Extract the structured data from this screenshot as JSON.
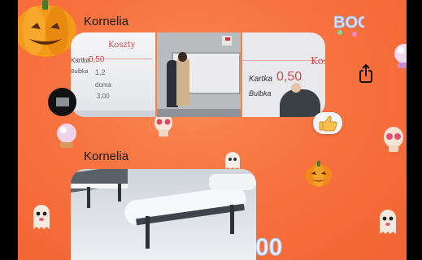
{
  "messages": [
    {
      "sender": "Kornelia",
      "reaction": "thumbs-up"
    },
    {
      "sender": "Kornelia"
    }
  ],
  "whiteboard": {
    "title": "Koszty",
    "rows": [
      {
        "label": "Kartka",
        "value": "0,50"
      },
      {
        "label": "Bulbka",
        "value": "1,2"
      },
      {
        "label": "",
        "value": "doma"
      },
      {
        "label": "",
        "value": "3,00"
      }
    ]
  },
  "controls": {
    "share_icon": "share-icon",
    "reaction_icon": "thumbs-up-icon"
  },
  "colors": {
    "background": "#f7733f",
    "bubble": "#ffffff"
  }
}
